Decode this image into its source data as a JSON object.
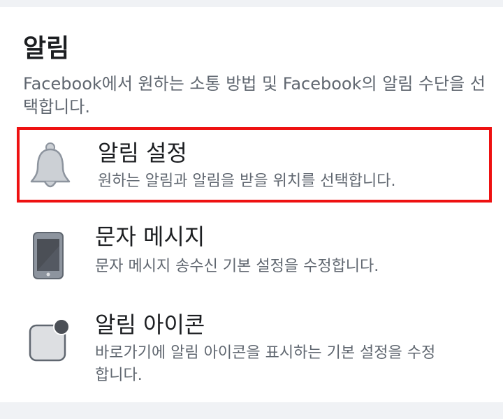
{
  "section": {
    "title": "알림",
    "description": "Facebook에서 원하는 소통 방법 및 Facebook의 알림 수단을 선택합니다."
  },
  "items": [
    {
      "title": "알림 설정",
      "description": "원하는 알림과 알림을 받을 위치를 선택합니다.",
      "icon": "bell-icon",
      "highlighted": true
    },
    {
      "title": "문자 메시지",
      "description": "문자 메시지 송수신 기본 설정을 수정합니다.",
      "icon": "phone-icon",
      "highlighted": false
    },
    {
      "title": "알림 아이콘",
      "description": "바로가기에 알림 아이콘을 표시하는 기본 설정을 수정합니다.",
      "icon": "notification-badge-icon",
      "highlighted": false
    }
  ],
  "colors": {
    "highlight_border": "#ee1111",
    "icon_fill": "#ccd0d5",
    "icon_stroke": "#8d949e"
  }
}
